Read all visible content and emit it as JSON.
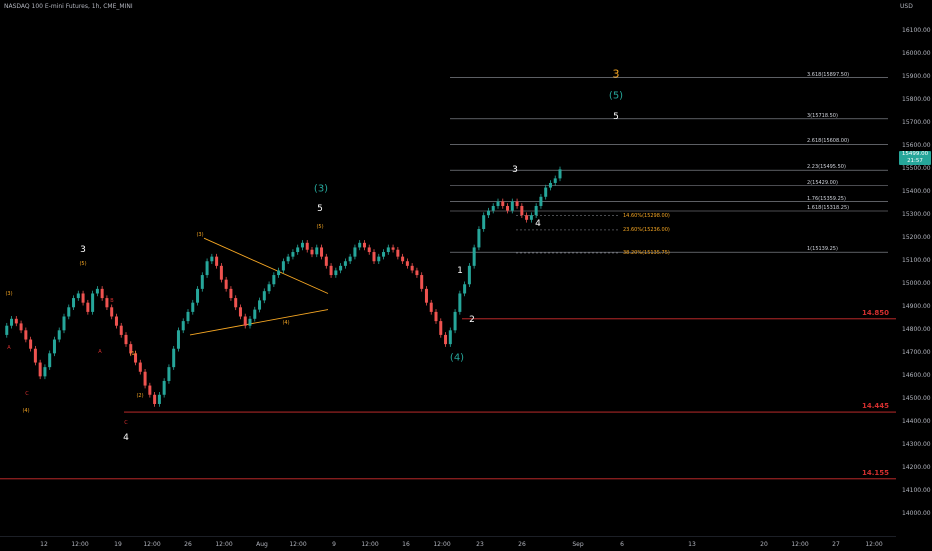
{
  "header": {
    "title": "NASDAQ 100 E-mini Futures, 1h, CME_MINI",
    "currency": "USD"
  },
  "price_tag": {
    "value": "15499.00",
    "sub": "21:57"
  },
  "chart_data": {
    "type": "line",
    "ylim": [
      13950,
      16200
    ],
    "y_ticks": [
      "16100.00",
      "16000.00",
      "15900.00",
      "15800.00",
      "15700.00",
      "15600.00",
      "15500.00",
      "15400.00",
      "15300.00",
      "15200.00",
      "15100.00",
      "15000.00",
      "14900.00",
      "14800.00",
      "14700.00",
      "14600.00",
      "14500.00",
      "14400.00",
      "14300.00",
      "14200.00",
      "14100.00",
      "14000.00"
    ],
    "x_ticks": [
      "12",
      "12:00",
      "19",
      "12:00",
      "26",
      "12:00",
      "Aug",
      "12:00",
      "9",
      "12:00",
      "16",
      "12:00",
      "23",
      "26",
      "Sep",
      "6",
      "13",
      "20",
      "12:00",
      "27",
      "12:00"
    ],
    "series": [
      {
        "values": [
          14780,
          14820,
          14850,
          14830,
          14800,
          14760,
          14720,
          14660,
          14600,
          14640,
          14700,
          14760,
          14800,
          14860,
          14900,
          14940,
          14960,
          14920,
          14880,
          14960,
          14980,
          14940,
          14900,
          14860,
          14820,
          14780,
          14740,
          14700,
          14660,
          14620,
          14560,
          14520,
          14480,
          14520,
          14580,
          14640,
          14720,
          14800,
          14840,
          14880,
          14920,
          14980,
          15040,
          15100,
          15120,
          15080,
          15020,
          14980,
          14940,
          14900,
          14860,
          14820,
          14850,
          14890,
          14930,
          14970,
          15000,
          15040,
          15060,
          15100,
          15120,
          15140,
          15160,
          15180,
          15150,
          15130,
          15160,
          15120,
          15080,
          15040,
          15060,
          15080,
          15100,
          15120,
          15160,
          15180,
          15160,
          15140,
          15100,
          15120,
          15140,
          15160,
          15150,
          15120,
          15100,
          15080,
          15060,
          15040,
          14980,
          14920,
          14880,
          14840,
          14780,
          14740,
          14800,
          14880,
          14960,
          15000,
          15080,
          15160,
          15240,
          15300,
          15320,
          15340,
          15360,
          15340,
          15320,
          15360,
          15340,
          15300,
          15280,
          15300,
          15340,
          15380,
          15420,
          15440,
          15460,
          15499
        ]
      }
    ],
    "levels": [
      {
        "price": 14850,
        "label": "14.850",
        "color": "#d32f2f"
      },
      {
        "price": 14445,
        "label": "14.445",
        "color": "#d32f2f"
      },
      {
        "price": 14155,
        "label": "14.155",
        "color": "#d32f2f"
      }
    ],
    "fib_levels": [
      {
        "price": 15897.5,
        "label": "3.618(15897.50)"
      },
      {
        "price": 15718.5,
        "label": "3(15718.50)"
      },
      {
        "price": 15608,
        "label": "2.618(15608.00)"
      },
      {
        "price": 15495.5,
        "label": "2.23(15495.50)"
      },
      {
        "price": 15429,
        "label": "2(15429.00)"
      },
      {
        "price": 15359.25,
        "label": "1.76(15359.25)"
      },
      {
        "price": 15318.25,
        "label": "1.618(15318.25)"
      },
      {
        "price": 15139.25,
        "label": "1(15139.25)"
      }
    ],
    "retracements": [
      {
        "price": 15298,
        "label": "14.60%(15298.00)"
      },
      {
        "price": 15236,
        "label": "23.60%(15236.00)"
      },
      {
        "price": 15135.75,
        "label": "38.20%(15135.75)"
      }
    ],
    "wave_labels": [
      {
        "text": "3",
        "color": "#ffffff",
        "size": 9
      },
      {
        "text": "(5)",
        "color": "#f5a623",
        "size": 5
      },
      {
        "text": "(3)",
        "color": "#f5a623",
        "size": 5
      },
      {
        "text": "A",
        "color": "#d32f2f",
        "size": 5
      },
      {
        "text": "C",
        "color": "#d32f2f",
        "size": 5
      },
      {
        "text": "(4)",
        "color": "#f5a623",
        "size": 5
      },
      {
        "text": "B",
        "color": "#d32f2f",
        "size": 5
      },
      {
        "text": "(1)",
        "color": "#f5a623",
        "size": 5
      },
      {
        "text": "A",
        "color": "#d32f2f",
        "size": 5
      },
      {
        "text": "(2)",
        "color": "#f5a623",
        "size": 5
      },
      {
        "text": "C",
        "color": "#d32f2f",
        "size": 5
      },
      {
        "text": "4",
        "color": "#ffffff",
        "size": 9
      },
      {
        "text": "(3)",
        "color": "#f5a623",
        "size": 5
      },
      {
        "text": "(4)",
        "color": "#f5a623",
        "size": 5
      },
      {
        "text": "(5)",
        "color": "#f5a623",
        "size": 5
      },
      {
        "text": "(3)",
        "color": "#26a69a",
        "size": 10
      },
      {
        "text": "5",
        "color": "#ffffff",
        "size": 9
      },
      {
        "text": "1",
        "color": "#ffffff",
        "size": 9
      },
      {
        "text": "2",
        "color": "#ffffff",
        "size": 9
      },
      {
        "text": "(4)",
        "color": "#26a69a",
        "size": 10
      },
      {
        "text": "3",
        "color": "#ffffff",
        "size": 9
      },
      {
        "text": "4",
        "color": "#ffffff",
        "size": 9
      },
      {
        "text": "3",
        "color": "#f5a623",
        "size": 11
      },
      {
        "text": "(5)",
        "color": "#26a69a",
        "size": 10
      },
      {
        "text": "5",
        "color": "#ffffff",
        "size": 9
      }
    ]
  }
}
